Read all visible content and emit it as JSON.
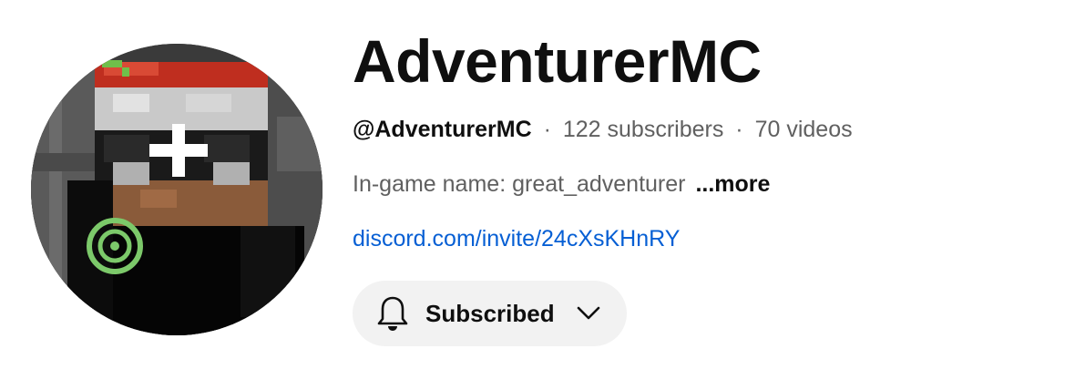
{
  "channel": {
    "name": "AdventurerMC",
    "handle": "@AdventurerMC",
    "subscribers": "122 subscribers",
    "videos": "70 videos",
    "separator": "·",
    "description": "In-game name: great_adventurer",
    "more_label": "...more",
    "link": "discord.com/invite/24cXsKHnRY",
    "avatar_icon": "minecraft-skin-avatar"
  },
  "subscribe_button": {
    "label": "Subscribed",
    "icon": "bell-icon",
    "dropdown_icon": "chevron-down-icon",
    "background": "#f2f2f2"
  },
  "colors": {
    "link": "#065fd4",
    "secondary_text": "#606060",
    "primary_text": "#0f0f0f"
  }
}
